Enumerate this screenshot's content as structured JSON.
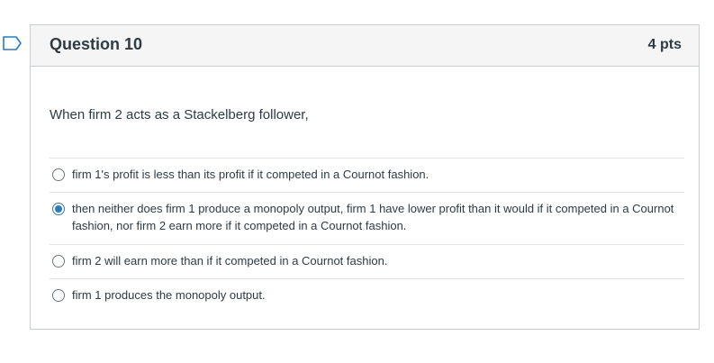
{
  "question": {
    "title": "Question 10",
    "points": "4 pts",
    "text": "When firm 2 acts as a Stackelberg follower,"
  },
  "answers": [
    {
      "label": "firm 1's profit is less than its profit if it competed in a Cournot fashion.",
      "selected": false
    },
    {
      "label": "then neither does firm 1 produce a monopoly output, firm 1 have lower profit than it would if it competed in a Cournot fashion, nor firm 2 earn more if it competed in a Cournot fashion.",
      "selected": true
    },
    {
      "label": "firm 2 will earn more than if it competed in a Cournot fashion.",
      "selected": false
    },
    {
      "label": "firm 1 produces the monopoly output.",
      "selected": false
    }
  ],
  "colors": {
    "accent": "#2b7abc",
    "header_bg": "#f5f5f5",
    "border": "#c7cdd1",
    "text": "#2d3b45"
  },
  "icons": {
    "flag": "flag-outline-icon"
  }
}
